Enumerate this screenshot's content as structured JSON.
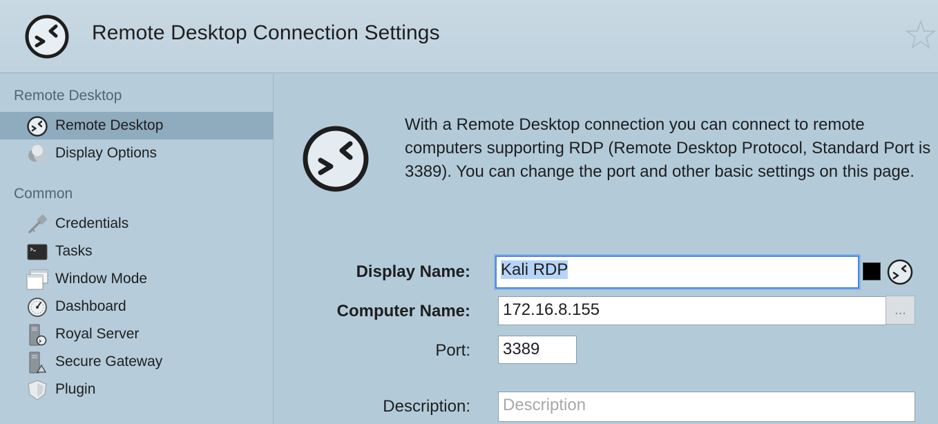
{
  "header": {
    "title": "Remote Desktop Connection Settings",
    "icon": "remote-desktop-icon",
    "favorite_icon": "star-icon"
  },
  "sidebar": {
    "sections": [
      {
        "title": "Remote Desktop",
        "items": [
          {
            "label": "Remote Desktop",
            "icon": "remote-desktop-icon",
            "selected": true
          },
          {
            "label": "Display Options",
            "icon": "display-options-icon",
            "selected": false
          }
        ]
      },
      {
        "title": "Common",
        "items": [
          {
            "label": "Credentials",
            "icon": "key-icon"
          },
          {
            "label": "Tasks",
            "icon": "terminal-icon"
          },
          {
            "label": "Window Mode",
            "icon": "window-icon"
          },
          {
            "label": "Dashboard",
            "icon": "dashboard-icon"
          },
          {
            "label": "Royal Server",
            "icon": "server-icon"
          },
          {
            "label": "Secure Gateway",
            "icon": "gateway-icon"
          },
          {
            "label": "Plugin",
            "icon": "plugin-icon"
          }
        ]
      }
    ]
  },
  "main": {
    "description": "With a Remote Desktop connection you can connect to remote computers supporting RDP (Remote Desktop Protocol, Standard Port is 3389). You can change the port and other basic settings on this page.",
    "form": {
      "display_name": {
        "label": "Display Name:",
        "value": "Kali RDP"
      },
      "computer_name": {
        "label": "Computer Name:",
        "value": "172.16.8.155",
        "browse_label": "..."
      },
      "port": {
        "label": "Port:",
        "value": "3389"
      },
      "description": {
        "label": "Description:",
        "value": "",
        "placeholder": "Description"
      }
    },
    "swatch_color": "#000000"
  },
  "colors": {
    "header_bg": "#c9d9e3",
    "sidebar_bg": "#b6ccda",
    "selected_bg": "#8fabbe",
    "main_bg": "#b3cbd9",
    "focus_ring": "#4b87d6"
  }
}
